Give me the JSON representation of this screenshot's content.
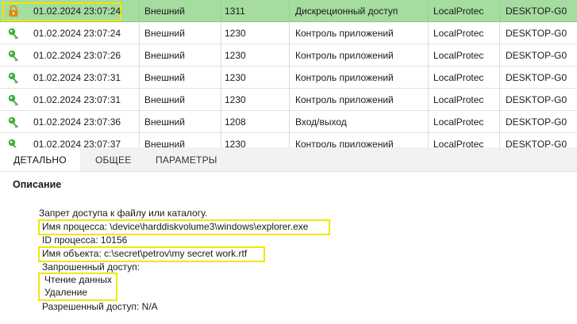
{
  "events": [
    {
      "icon": "lock-icon",
      "time": "01.02.2024 23:07:24",
      "type": "Внешний",
      "code": "1311",
      "category": "Дискреционный доступ",
      "source": "LocalProtec",
      "computer": "DESKTOP-G0",
      "selected": true
    },
    {
      "icon": "key-icon",
      "time": "01.02.2024 23:07:24",
      "type": "Внешний",
      "code": "1230",
      "category": "Контроль приложений",
      "source": "LocalProtec",
      "computer": "DESKTOP-G0",
      "selected": false
    },
    {
      "icon": "key-icon",
      "time": "01.02.2024 23:07:26",
      "type": "Внешний",
      "code": "1230",
      "category": "Контроль приложений",
      "source": "LocalProtec",
      "computer": "DESKTOP-G0",
      "selected": false
    },
    {
      "icon": "key-icon",
      "time": "01.02.2024 23:07:31",
      "type": "Внешний",
      "code": "1230",
      "category": "Контроль приложений",
      "source": "LocalProtec",
      "computer": "DESKTOP-G0",
      "selected": false
    },
    {
      "icon": "key-icon",
      "time": "01.02.2024 23:07:31",
      "type": "Внешний",
      "code": "1230",
      "category": "Контроль приложений",
      "source": "LocalProtec",
      "computer": "DESKTOP-G0",
      "selected": false
    },
    {
      "icon": "key-icon",
      "time": "01.02.2024 23:07:36",
      "type": "Внешний",
      "code": "1208",
      "category": "Вход/выход",
      "source": "LocalProtec",
      "computer": "DESKTOP-G0",
      "selected": false
    },
    {
      "icon": "key-icon",
      "time": "01.02.2024 23:07:37",
      "type": "Внешний",
      "code": "1230",
      "category": "Контроль приложений",
      "source": "LocalProtec",
      "computer": "DESKTOP-G0",
      "selected": false
    }
  ],
  "tabs": [
    {
      "label": "ДЕТАЛЬНО",
      "active": true
    },
    {
      "label": "ОБЩЕЕ",
      "active": false
    },
    {
      "label": "ПАРАМЕТРЫ",
      "active": false
    }
  ],
  "details": {
    "title": "Описание",
    "summary": "Запрет доступа к файлу или каталогу.",
    "process_name": "Имя процесса: \\device\\harddiskvolume3\\windows\\explorer.exe",
    "process_id": "ID процесса: 10156",
    "object_name": "Имя объекта: c:\\secret\\petrov\\my secret work.rtf",
    "requested_label": "Запрошенный доступ:",
    "requested_items": [
      "Чтение данных",
      "Удаление"
    ],
    "allowed": "Разрешенный доступ: N/A"
  },
  "colors": {
    "selected_row": "#a5dca0",
    "highlight": "#f2e600",
    "key_green": "#3fae3a",
    "lock_orange": "#e38a12"
  }
}
